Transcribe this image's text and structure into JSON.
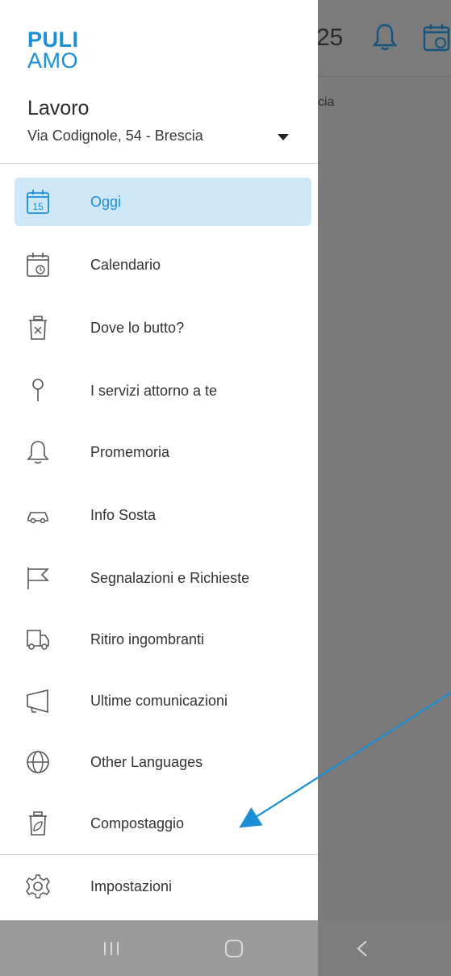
{
  "background": {
    "date_fragment": "25",
    "subtitle_fragment": "cia",
    "icons": [
      "bell-icon",
      "calendar-icon"
    ]
  },
  "drawer": {
    "logo": {
      "line1": "PULI",
      "line2": "AMO"
    },
    "place": {
      "name": "Lavoro",
      "address": "Via Codignole, 54 - Brescia"
    },
    "items": [
      {
        "label": "Oggi",
        "icon": "calendar-today-icon",
        "active": true
      },
      {
        "label": "Calendario",
        "icon": "calendar-clock-icon"
      },
      {
        "label": "Dove lo butto?",
        "icon": "trash-icon"
      },
      {
        "label": "I servizi attorno a te",
        "icon": "location-pin-icon"
      },
      {
        "label": "Promemoria",
        "icon": "bell-icon"
      },
      {
        "label": "Info Sosta",
        "icon": "car-icon"
      },
      {
        "label": "Segnalazioni e Richieste",
        "icon": "flag-icon"
      },
      {
        "label": "Ritiro ingombranti",
        "icon": "truck-icon"
      },
      {
        "label": "Ultime comunicazioni",
        "icon": "megaphone-icon"
      },
      {
        "label": "Other Languages",
        "icon": "globe-icon"
      },
      {
        "label": "Compostaggio",
        "icon": "compost-bin-icon"
      }
    ],
    "settings": {
      "label": "Impostazioni",
      "icon": "gear-icon"
    },
    "accent": "#1a8fd6",
    "active_bg": "#cfe8f7"
  },
  "navbar": {
    "buttons": [
      "recent-apps-icon",
      "home-icon",
      "back-icon"
    ]
  }
}
